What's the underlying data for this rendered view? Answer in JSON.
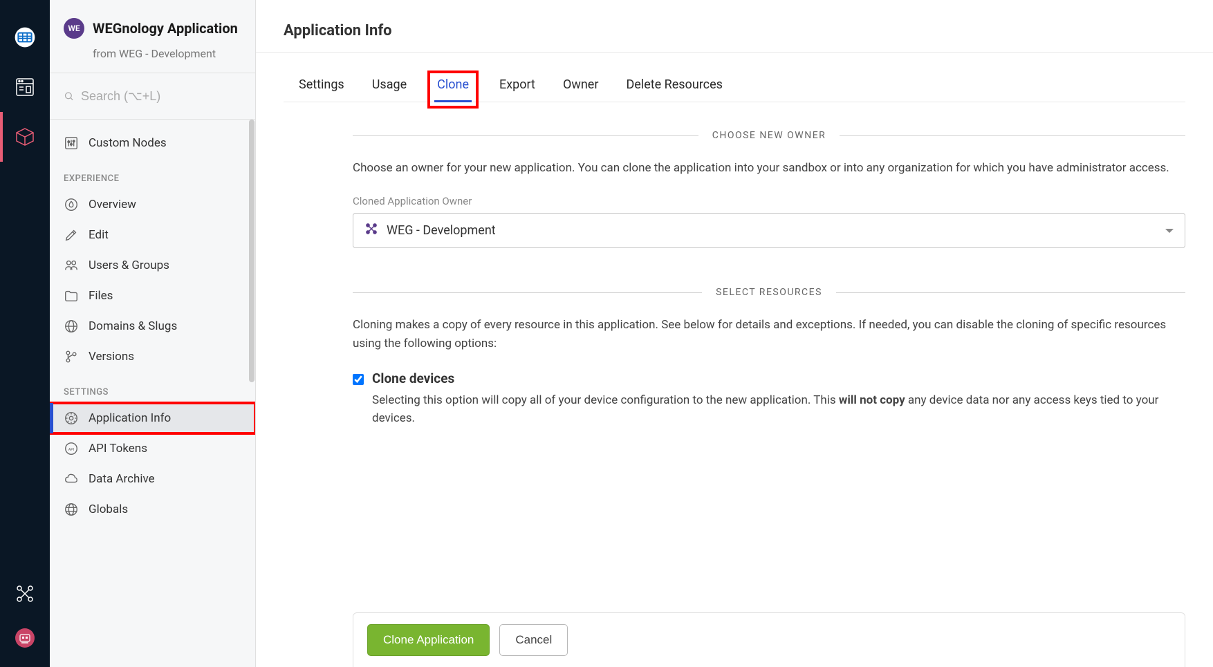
{
  "header": {
    "org_badge": "WE",
    "app_title": "WEGnology Application",
    "app_subtitle": "from WEG - Development"
  },
  "search": {
    "placeholder": "Search (⌥+L)"
  },
  "page_title": "Application Info",
  "sidebar": {
    "items": {
      "custom_nodes": "Custom Nodes",
      "overview": "Overview",
      "edit": "Edit",
      "users_groups": "Users & Groups",
      "files": "Files",
      "domains_slugs": "Domains & Slugs",
      "versions": "Versions",
      "application_info": "Application Info",
      "api_tokens": "API Tokens",
      "data_archive": "Data Archive",
      "globals": "Globals"
    },
    "sections": {
      "experience": "EXPERIENCE",
      "settings": "SETTINGS"
    }
  },
  "tabs": {
    "settings": "Settings",
    "usage": "Usage",
    "clone": "Clone",
    "export": "Export",
    "owner": "Owner",
    "delete": "Delete Resources"
  },
  "owner_section": {
    "title": "CHOOSE NEW OWNER",
    "desc": "Choose an owner for your new application. You can clone the application into your sandbox or into any organization for which you have administrator access.",
    "field_label": "Cloned Application Owner",
    "selected": "WEG - Development"
  },
  "resources_section": {
    "title": "SELECT RESOURCES",
    "desc": "Cloning makes a copy of every resource in this application. See below for details and exceptions. If needed, you can disable the cloning of specific resources using the following options:",
    "clone_devices_label": "Clone devices",
    "clone_devices_desc_pre": "Selecting this option will copy all of your device configuration to the new application. This ",
    "clone_devices_desc_bold": "will not copy",
    "clone_devices_desc_post": " any device data nor any access keys tied to your devices."
  },
  "footer": {
    "clone": "Clone Application",
    "cancel": "Cancel"
  }
}
